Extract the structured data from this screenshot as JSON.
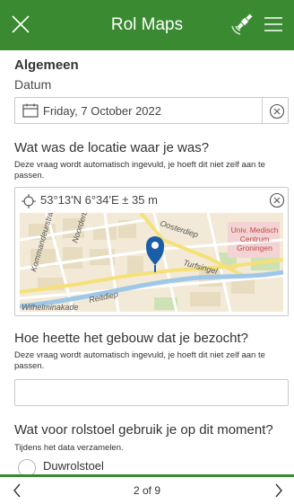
{
  "app": {
    "title": "Rol Maps"
  },
  "icons": {
    "close": "close-icon",
    "gps": "gps-satellite-icon",
    "menu": "hamburger-menu-icon"
  },
  "colors": {
    "header": "#3a8a31",
    "pin": "#1b5ea8"
  },
  "group": {
    "title": "Algemeen"
  },
  "date_field": {
    "label": "Datum",
    "value": "Friday, 7 October 2022"
  },
  "location_question": {
    "label": "Wat was de locatie waar je was?",
    "hint": "Deze vraag wordt automatisch ingevuld, je hoeft dit niet zelf aan te passen.",
    "coords": "53°13'N 6°34'E ± 35 m",
    "map_labels": {
      "street1": "Oosterdiep",
      "street2": "Turfsingel",
      "street3": "Reitdiep",
      "street4": "Noorderbinnen...",
      "street5": "Kommandeurstraat",
      "street6": "Wilhelminakade",
      "poi": "Univ. Medisch Centrum Groningen",
      "poi_l1": "Univ. Medisch",
      "poi_l2": "Centrum",
      "poi_l3": "Groningen"
    }
  },
  "building_question": {
    "label": "Hoe heette het gebouw dat je bezocht?",
    "hint": "Deze vraag wordt automatisch ingevuld, je hoeft dit niet zelf aan te passen.",
    "value": ""
  },
  "wheelchair_question": {
    "label": "Wat voor rolstoel gebruik je op dit moment?",
    "hint": "Tijdens het data verzamelen.",
    "options": [
      "Duwrolstoel"
    ]
  },
  "footer": {
    "page": "2 of 9"
  }
}
